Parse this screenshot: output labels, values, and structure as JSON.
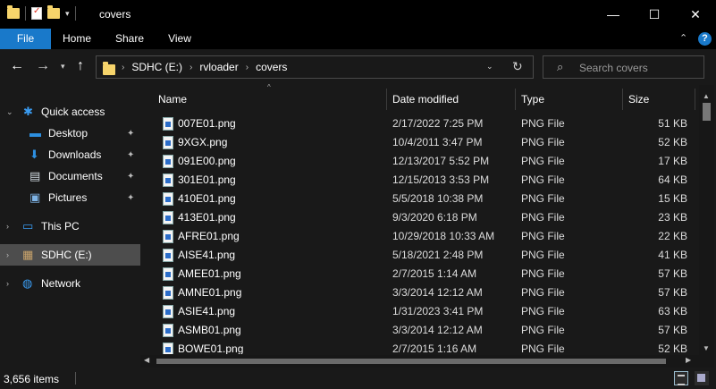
{
  "window": {
    "title": "covers",
    "minimize_glyph": "—",
    "maximize_glyph": "☐",
    "close_glyph": "✕"
  },
  "quick_access_toolbar": {
    "icons": [
      "folder-icon",
      "properties-icon",
      "new-folder-icon"
    ],
    "dropdown_glyph": "▾"
  },
  "ribbon": {
    "tabs": [
      {
        "label": "File"
      },
      {
        "label": "Home"
      },
      {
        "label": "Share"
      },
      {
        "label": "View"
      }
    ],
    "collapse_glyph": "⌃",
    "help_glyph": "?",
    "accent_color": "#1979ca"
  },
  "navigation": {
    "back_glyph": "←",
    "forward_glyph": "→",
    "recent_glyph": "▾",
    "up_glyph": "↑",
    "breadcrumbs": [
      "SDHC (E:)",
      "rvloader",
      "covers"
    ],
    "crumb_separator": "›",
    "dropdown_glyph": "⌄",
    "refresh_glyph": "↻"
  },
  "search": {
    "placeholder": "Search covers",
    "icon_glyph": "⌕"
  },
  "nav_pane": {
    "items": [
      {
        "label": "Quick access",
        "icon": "star-icon",
        "glyph": "✱",
        "chevron": "⌄",
        "pinned": false
      },
      {
        "label": "Desktop",
        "icon": "desktop-icon",
        "glyph": "▬",
        "pinned": true
      },
      {
        "label": "Downloads",
        "icon": "download-icon",
        "glyph": "⬇",
        "pinned": true
      },
      {
        "label": "Documents",
        "icon": "documents-icon",
        "glyph": "▤",
        "pinned": true
      },
      {
        "label": "Pictures",
        "icon": "pictures-icon",
        "glyph": "▣",
        "pinned": true
      },
      {
        "label": "This PC",
        "icon": "computer-icon",
        "glyph": "▭",
        "chevron": "›"
      },
      {
        "label": "SDHC (E:)",
        "icon": "sd-card-icon",
        "glyph": "▦",
        "chevron": "›",
        "selected": true
      },
      {
        "label": "Network",
        "icon": "network-icon",
        "glyph": "◍",
        "chevron": "›"
      }
    ],
    "pin_glyph": "📌"
  },
  "file_list": {
    "sort_indicator": "^",
    "columns": [
      "Name",
      "Date modified",
      "Type",
      "Size"
    ],
    "rows": [
      {
        "name": "007E01.png",
        "date": "2/17/2022 7:25 PM",
        "type": "PNG File",
        "size": "51 KB"
      },
      {
        "name": "9XGX.png",
        "date": "10/4/2011 3:47 PM",
        "type": "PNG File",
        "size": "52 KB"
      },
      {
        "name": "091E00.png",
        "date": "12/13/2017 5:52 PM",
        "type": "PNG File",
        "size": "17 KB"
      },
      {
        "name": "301E01.png",
        "date": "12/15/2013 3:53 PM",
        "type": "PNG File",
        "size": "64 KB"
      },
      {
        "name": "410E01.png",
        "date": "5/5/2018 10:38 PM",
        "type": "PNG File",
        "size": "15 KB"
      },
      {
        "name": "413E01.png",
        "date": "9/3/2020 6:18 PM",
        "type": "PNG File",
        "size": "23 KB"
      },
      {
        "name": "AFRE01.png",
        "date": "10/29/2018 10:33 AM",
        "type": "PNG File",
        "size": "22 KB"
      },
      {
        "name": "AISE41.png",
        "date": "5/18/2021 2:48 PM",
        "type": "PNG File",
        "size": "41 KB"
      },
      {
        "name": "AMEE01.png",
        "date": "2/7/2015 1:14 AM",
        "type": "PNG File",
        "size": "57 KB"
      },
      {
        "name": "AMNE01.png",
        "date": "3/3/2014 12:12 AM",
        "type": "PNG File",
        "size": "57 KB"
      },
      {
        "name": "ASIE41.png",
        "date": "1/31/2023 3:41 PM",
        "type": "PNG File",
        "size": "63 KB"
      },
      {
        "name": "ASMB01.png",
        "date": "3/3/2014 12:12 AM",
        "type": "PNG File",
        "size": "57 KB"
      },
      {
        "name": "BOWE01.png",
        "date": "2/7/2015 1:16 AM",
        "type": "PNG File",
        "size": "52 KB"
      }
    ]
  },
  "scrollbars": {
    "up_glyph": "▲",
    "down_glyph": "▼",
    "left_glyph": "◀",
    "right_glyph": "▶"
  },
  "status_bar": {
    "item_count": "3,656 items"
  }
}
